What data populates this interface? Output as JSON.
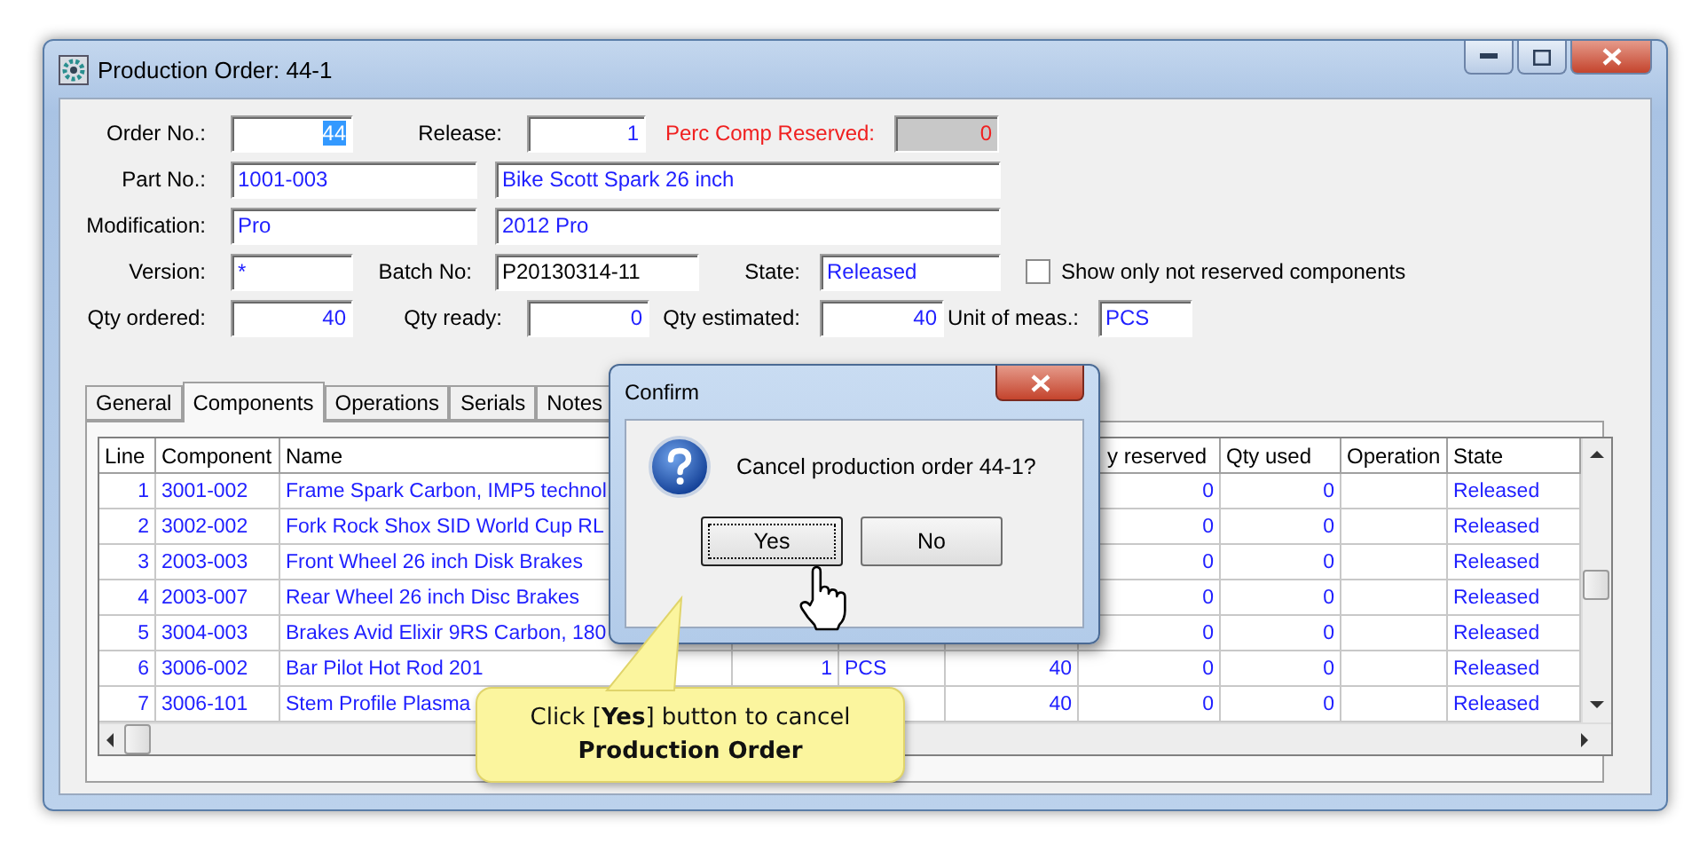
{
  "window": {
    "title": "Production Order: 44-1"
  },
  "form": {
    "rows": [
      [
        {
          "kind": "label",
          "text": "Order No.:"
        },
        {
          "kind": "field",
          "value": "44",
          "selected": true
        },
        {
          "kind": "label",
          "text": "Release:"
        },
        {
          "kind": "field",
          "value": "1",
          "selected": false
        },
        {
          "kind": "warning",
          "text": "Perc Comp Reserved:"
        },
        {
          "kind": "readonly",
          "value": "0",
          "selected": false
        }
      ],
      [
        {
          "kind": "label",
          "text": "Part No.:"
        },
        {
          "kind": "field",
          "value": "1001-003",
          "selected": false
        },
        {
          "kind": "field",
          "value": "Bike Scott Spark 26 inch",
          "selected": false
        }
      ],
      [
        {
          "kind": "label",
          "text": "Modification:"
        },
        {
          "kind": "field",
          "value": "Pro",
          "selected": false
        },
        {
          "kind": "field",
          "value": "2012 Pro",
          "selected": false
        }
      ],
      [
        {
          "kind": "label",
          "text": "Version:"
        },
        {
          "kind": "field",
          "value": "*",
          "selected": false
        },
        {
          "kind": "label",
          "text": "Batch No:"
        },
        {
          "kind": "plainfield",
          "value": "P20130314-11",
          "selected": false
        },
        {
          "kind": "label",
          "text": "State:"
        },
        {
          "kind": "field",
          "value": "Released",
          "selected": false
        },
        {
          "kind": "checkbox",
          "text": "Show only not reserved components",
          "checked": false
        }
      ],
      [
        {
          "kind": "label",
          "text": "Qty ordered:"
        },
        {
          "kind": "field",
          "value": "40",
          "selected": false
        },
        {
          "kind": "label",
          "text": "Qty ready:"
        },
        {
          "kind": "field",
          "value": "0",
          "selected": false
        },
        {
          "kind": "label",
          "text": "Qty estimated:"
        },
        {
          "kind": "field",
          "value": "40",
          "selected": false
        },
        {
          "kind": "label",
          "text": "Unit of meas.:"
        },
        {
          "kind": "field",
          "value": "PCS",
          "selected": false
        }
      ]
    ]
  },
  "tabs": [
    {
      "label": "General",
      "selected": false
    },
    {
      "label": "Components",
      "selected": true
    },
    {
      "label": "Operations",
      "selected": false
    },
    {
      "label": "Serials",
      "selected": false
    },
    {
      "label": "Notes",
      "selected": false
    }
  ],
  "table": {
    "columns_left": [
      "Line",
      "Component",
      "Name"
    ],
    "columns_right": [
      "y reserved",
      "Qty used",
      "Operation",
      "State"
    ],
    "rows": [
      {
        "line": "1",
        "component": "3001-002",
        "name": "Frame Spark Carbon, IMP5 technol",
        "reserved": "0",
        "used": "0",
        "state": "Released"
      },
      {
        "line": "2",
        "component": "3002-002",
        "name": "Fork Rock Shox SID World Cup RL",
        "reserved": "0",
        "used": "0",
        "state": "Released"
      },
      {
        "line": "3",
        "component": "2003-003",
        "name": "Front Wheel 26 inch Disk Brakes",
        "reserved": "0",
        "used": "0",
        "state": "Released"
      },
      {
        "line": "4",
        "component": "2003-007",
        "name": "Rear Wheel 26 inch Disc Brakes",
        "reserved": "0",
        "used": "0",
        "state": "Released"
      },
      {
        "line": "5",
        "component": "3004-003",
        "name": "Brakes Avid Elixir 9RS Carbon, 180",
        "reserved": "0",
        "used": "0",
        "state": "Released"
      },
      {
        "line": "6",
        "component": "3006-002",
        "name": "Bar Pilot Hot Rod 201",
        "column_4": "1",
        "column_5": "PCS",
        "column_6": "40",
        "reserved": "0",
        "used": "0",
        "state": "Released"
      },
      {
        "line": "7",
        "component": "3006-101",
        "name": "Stem Profile Plasma",
        "column_6": "40",
        "reserved": "0",
        "used": "0",
        "state": "Released"
      }
    ]
  },
  "dialog": {
    "title": "Confirm",
    "message": "Cancel production order 44-1?",
    "buttons": [
      {
        "label": "Yes",
        "focused": true
      },
      {
        "label": "No",
        "focused": false
      }
    ]
  },
  "callout": {
    "text": "Click [**Yes**] button to cancel **Production Order**"
  }
}
